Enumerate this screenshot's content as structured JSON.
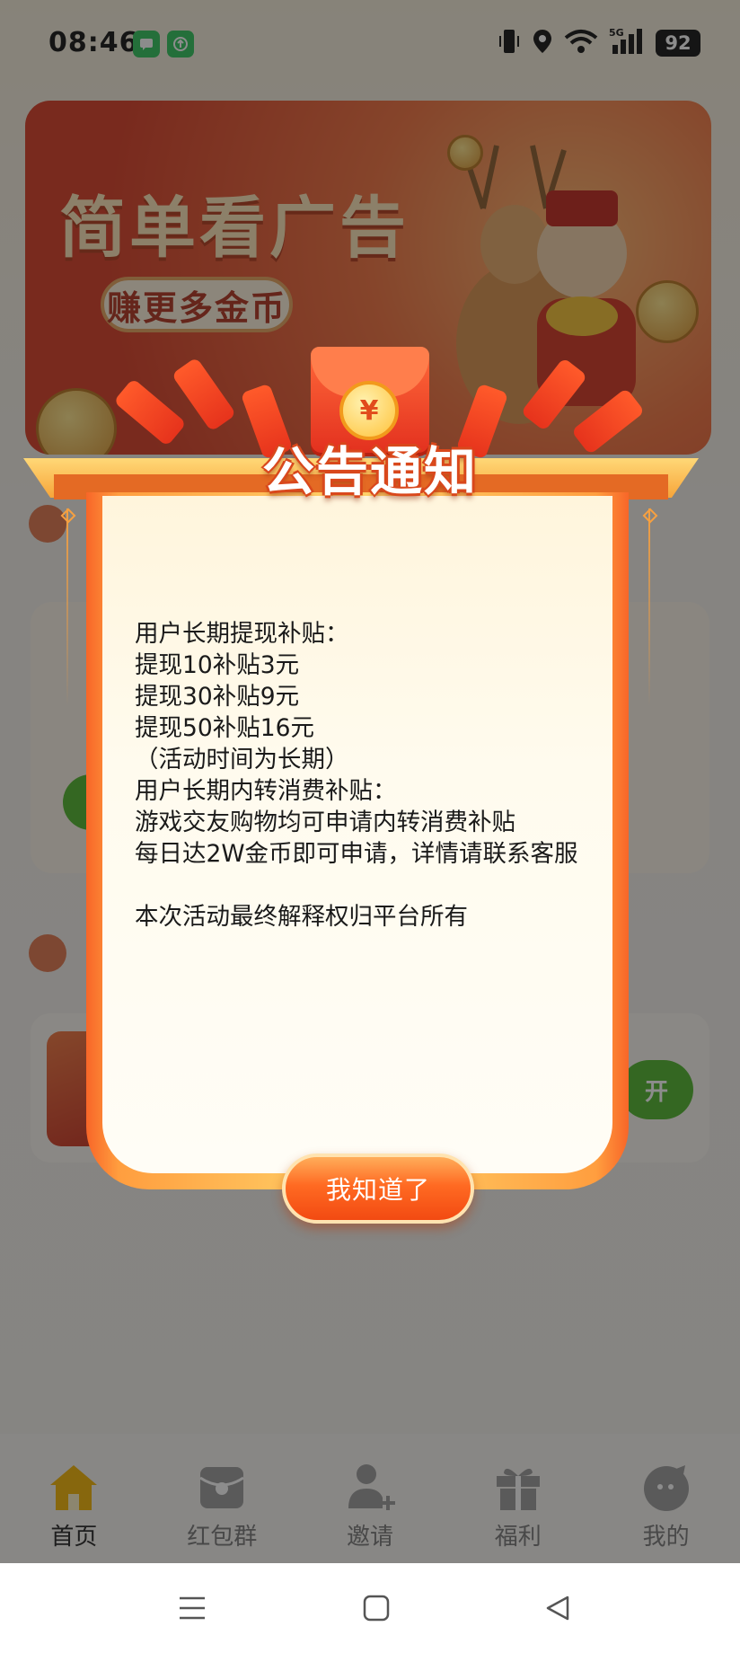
{
  "status_bar": {
    "time": "08:46",
    "battery": "92",
    "network": "5G"
  },
  "banner": {
    "title": "简单看广告",
    "subtitle": "赚更多金币"
  },
  "background_card": {
    "button_label": "开"
  },
  "dialog": {
    "title": "公告通知",
    "envelope_symbol": "¥",
    "lines": [
      "用户长期提现补贴：",
      "提现10补贴3元",
      "提现30补贴9元",
      "提现50补贴16元",
      "（活动时间为长期）",
      "用户长期内转消费补贴：",
      "游戏交友购物均可申请内转消费补贴",
      "每日达2W金币即可申请，详情请联系客服",
      "",
      "本次活动最终解释权归平台所有"
    ],
    "confirm_button": "我知道了"
  },
  "tabbar": {
    "tabs": [
      {
        "label": "首页",
        "icon": "home-icon",
        "active": true
      },
      {
        "label": "红包群",
        "icon": "red-packet-icon",
        "active": false
      },
      {
        "label": "邀请",
        "icon": "invite-user-icon",
        "active": false
      },
      {
        "label": "福利",
        "icon": "gift-icon",
        "active": false
      },
      {
        "label": "我的",
        "icon": "profile-icon",
        "active": false
      }
    ]
  },
  "navbar": {
    "buttons": [
      "menu-icon",
      "home-square-icon",
      "back-triangle-icon"
    ]
  },
  "colors": {
    "accent_orange": "#ff6a22",
    "tab_active": "#f5b400",
    "green_button": "#4fb52a",
    "title_stroke": "#d9481c"
  }
}
